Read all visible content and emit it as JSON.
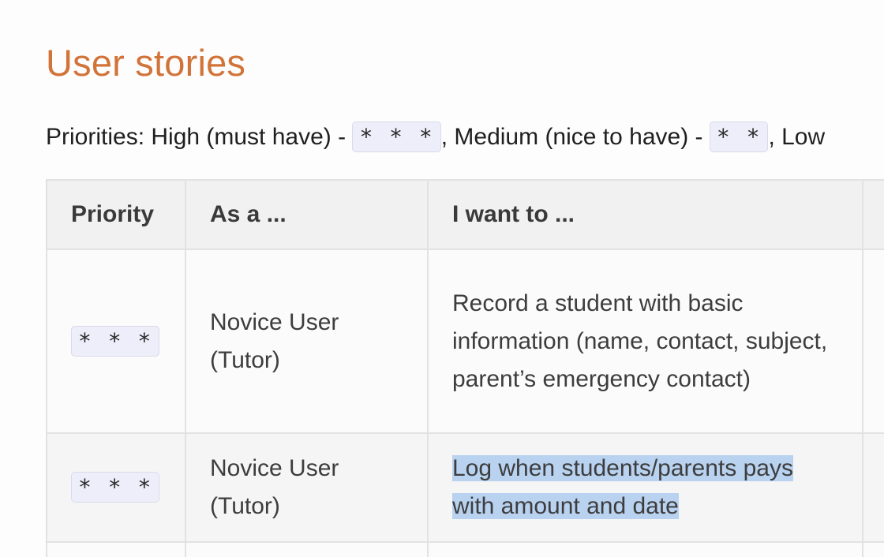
{
  "title": "User stories",
  "priorities": {
    "prefix": "Priorities: High (must have) - ",
    "high_code": "* * *",
    "mid_text": ", Medium (nice to have) - ",
    "medium_code": "* *",
    "suffix": ", Low"
  },
  "table": {
    "headers": [
      "Priority",
      "As a ...",
      "I want to ..."
    ],
    "rows": [
      {
        "priority": "* * *",
        "as_a": "Novice User (Tutor)",
        "i_want_to": "Record a student with basic information (name, contact, subject, parent’s emergency contact)"
      },
      {
        "priority": "* * *",
        "as_a": "Novice User (Tutor)",
        "i_want_to": "Log when students/parents pays with amount and date"
      }
    ]
  },
  "colors": {
    "title": "#d2743a",
    "code_bg": "#eeeefb",
    "selection": "#b8d2f0",
    "header_bg": "#f1f1f1"
  }
}
